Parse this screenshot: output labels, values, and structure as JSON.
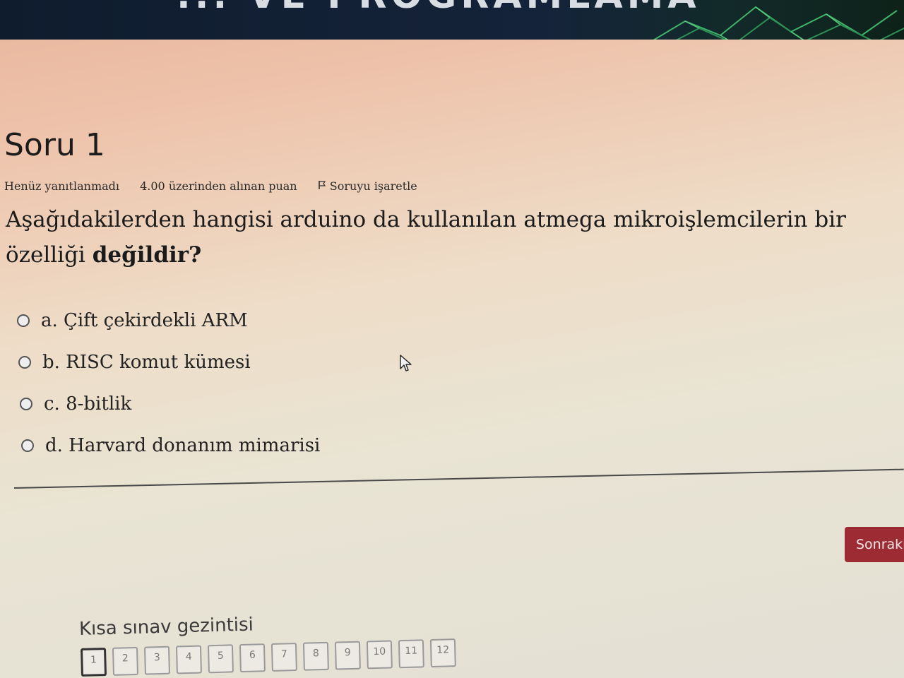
{
  "banner": {
    "title": "... VE PROGRAMLAMA"
  },
  "question": {
    "title": "Soru 1",
    "status": "Henüz yanıtlanmadı",
    "points": "4.00 üzerinden alınan puan",
    "flag_label": "Soruyu işaretle",
    "text_main": "Aşağıdakilerden hangisi arduino da kullanılan atmega mikroişlemcilerin bir özelliği ",
    "text_bold": "değildir?",
    "answers": [
      {
        "label": "a. Çift çekirdekli ARM"
      },
      {
        "label": "b. RISC komut kümesi"
      },
      {
        "label": "c. 8-bitlik"
      },
      {
        "label": "d. Harvard donanım mimarisi"
      }
    ]
  },
  "next_button": {
    "label": "Sonraki"
  },
  "quiz_nav": {
    "title": "Kısa sınav gezintisi",
    "pages": [
      "1",
      "2",
      "3",
      "4",
      "5",
      "6",
      "7",
      "8",
      "9",
      "10",
      "11",
      "12"
    ]
  },
  "colors": {
    "next_button_bg": "#9d2b34",
    "banner_bg": "#0f1c2e"
  }
}
